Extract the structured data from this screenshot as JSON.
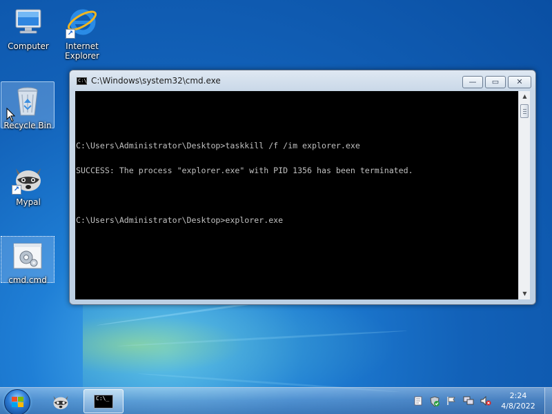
{
  "desktop": {
    "icons": [
      {
        "label": "Computer",
        "icon": "computer-icon"
      },
      {
        "label": "Internet Explorer",
        "icon": "internet-explorer-icon"
      },
      {
        "label": "Recycle Bin",
        "icon": "recycle-bin-icon"
      },
      {
        "label": "Mypal",
        "icon": "mypal-raccoon-icon"
      },
      {
        "label": "cmd.cmd",
        "icon": "batch-file-gear-icon"
      }
    ]
  },
  "window": {
    "title": "C:\\Windows\\system32\\cmd.exe",
    "minimize": "—",
    "maximize": "▭",
    "close": "✕",
    "console_lines": [
      "",
      "C:\\Users\\Administrator\\Desktop>taskkill /f /im explorer.exe",
      "SUCCESS: The process \"explorer.exe\" with PID 1356 has been terminated.",
      "",
      "C:\\Users\\Administrator\\Desktop>explorer.exe"
    ]
  },
  "taskbar": {
    "items": [
      {
        "name": "mypal",
        "icon": "mypal-raccoon-icon"
      },
      {
        "name": "cmd",
        "icon": "command-prompt-icon",
        "active": true
      }
    ],
    "tray": [
      "notes-icon",
      "security-shield-icon",
      "action-center-flag-icon",
      "network-icon",
      "volume-muted-icon"
    ],
    "clock": {
      "time": "2:24",
      "date": "4/8/2022"
    }
  },
  "colors": {
    "desktop_bg": "#1261b8",
    "console_bg": "#000000",
    "console_text": "#c0c0c0"
  }
}
